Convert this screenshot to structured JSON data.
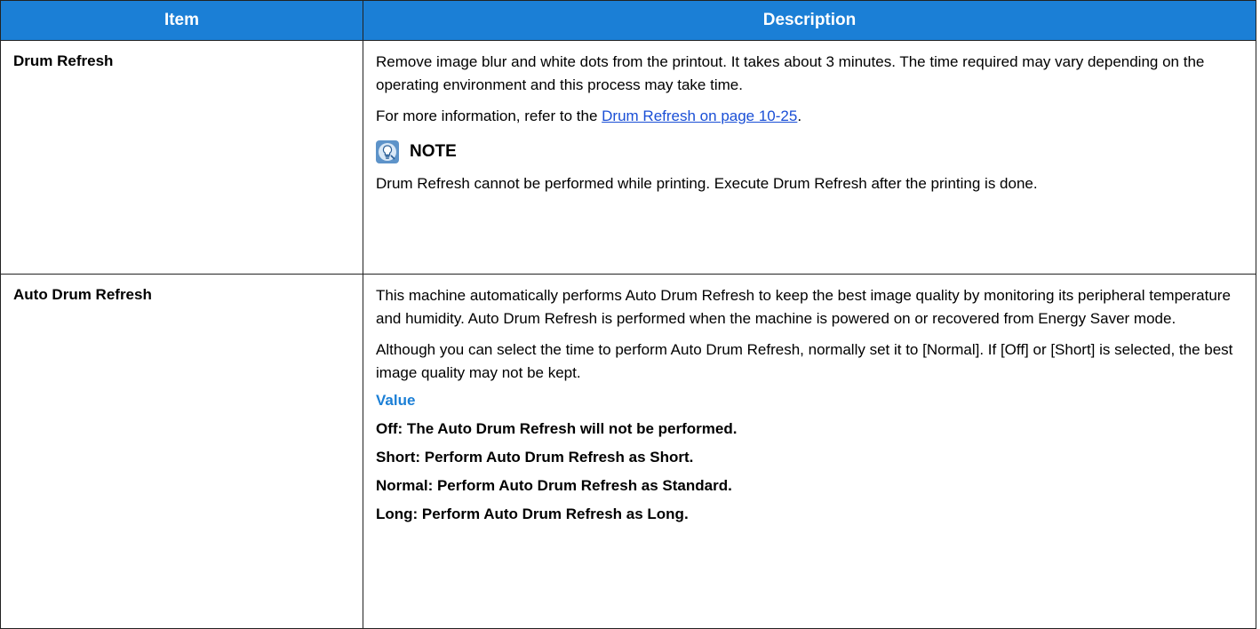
{
  "table": {
    "headers": [
      "Item",
      "Description"
    ],
    "rows": [
      {
        "item": "Drum Refresh",
        "desc_p1": "Remove image blur and white dots from the printout. It takes about 3 minutes. The time required may vary depending on the operating environment and this process may take time.",
        "desc_p2_prefix": "For more information, refer to the ",
        "desc_p2_link": "Drum Refresh on page 10-25",
        "desc_p2_suffix": ".",
        "note_label": "NOTE",
        "note_text": "Drum Refresh cannot be performed while printing. Execute Drum Refresh after the printing is done."
      },
      {
        "item": "Auto Drum Refresh",
        "desc_p1": "This machine automatically performs Auto Drum Refresh to keep the best image quality by monitoring its peripheral temperature and humidity. Auto Drum Refresh is performed when the machine is powered on or recovered from Energy Saver mode.",
        "desc_p2": "Although you can select the time to perform Auto Drum Refresh, normally set it to [Normal]. If [Off] or [Short] is selected, the best image quality may not be kept.",
        "value_title": "Value",
        "values": [
          "Off: The Auto Drum Refresh will not be performed.",
          "Short: Perform Auto Drum Refresh as Short.",
          "Normal: Perform Auto Drum Refresh as Standard.",
          "Long: Perform Auto Drum Refresh as Long."
        ]
      }
    ]
  },
  "colors": {
    "header_bg": "#1b7fd6",
    "link": "#1a4fd6",
    "value_title": "#1b7fd6",
    "note_icon_bg": "#5d93c9"
  },
  "icons": {
    "note": "note-lightbulb-icon"
  }
}
